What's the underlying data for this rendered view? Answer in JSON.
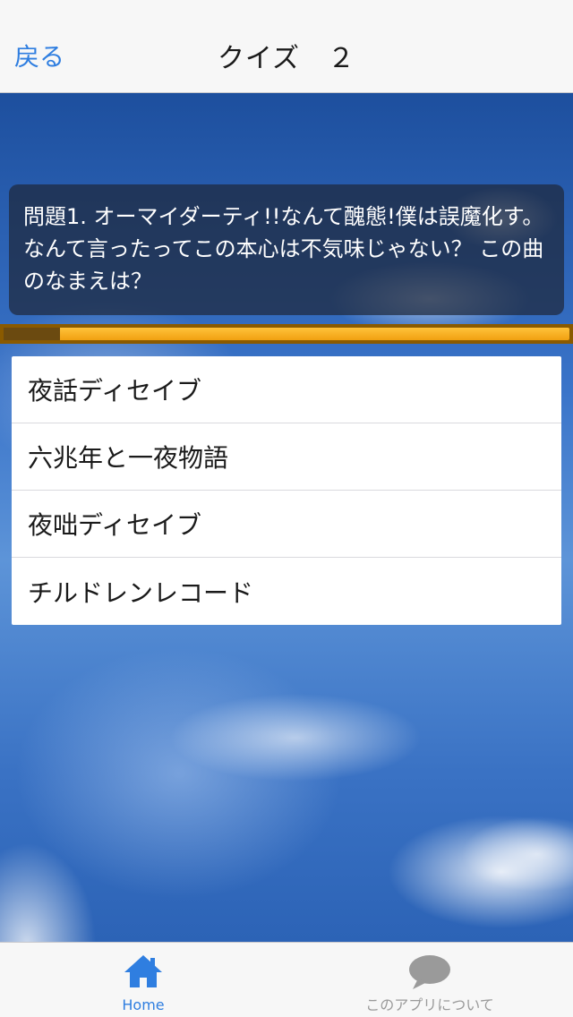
{
  "nav": {
    "back_label": "戻る",
    "title": "クイズ　２"
  },
  "question": {
    "text": "問題1. オーマイダーティ!!なんて醜態!僕は誤魔化す。なんて言ったってこの本心は不気味じゃない？ この曲のなまえは？"
  },
  "progress": {
    "fraction": 0.1
  },
  "answers": [
    {
      "label": "夜話ディセイブ"
    },
    {
      "label": "六兆年と一夜物語"
    },
    {
      "label": "夜咄ディセイブ"
    },
    {
      "label": "チルドレンレコード"
    }
  ],
  "tabbar": {
    "home_label": "Home",
    "about_label": "このアプリについて",
    "home_icon": "home-icon",
    "about_icon": "speech-bubble-icon",
    "active_color": "#2f7ee0",
    "inactive_color": "#9a9a9a"
  },
  "colors": {
    "accent": "#2f7ee0",
    "progress_track": "#f0a010",
    "progress_fill": "#6b4a10"
  }
}
